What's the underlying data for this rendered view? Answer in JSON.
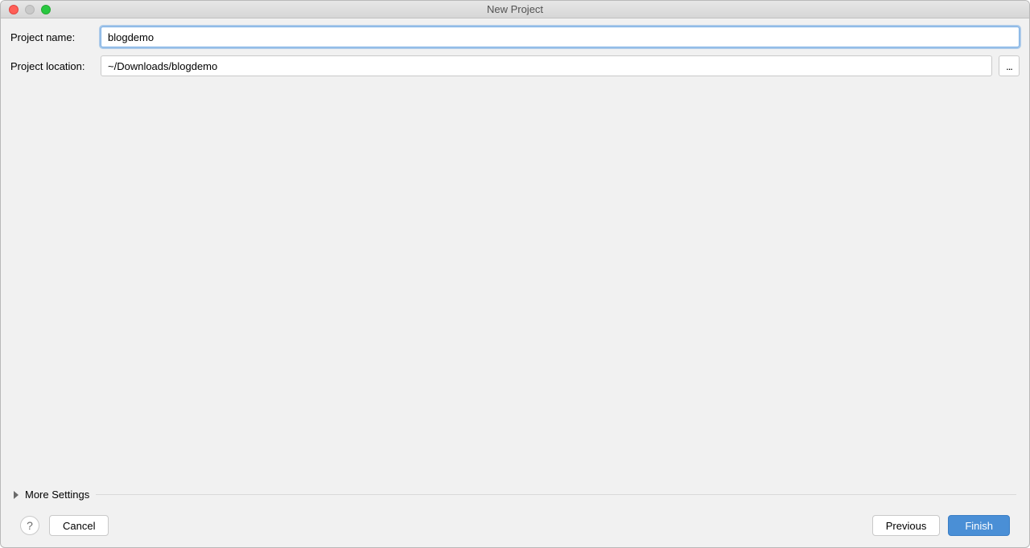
{
  "window": {
    "title": "New Project"
  },
  "form": {
    "project_name": {
      "label": "Project name:",
      "value": "blogdemo"
    },
    "project_location": {
      "label": "Project location:",
      "value": "~/Downloads/blogdemo",
      "browse_label": "..."
    }
  },
  "expander": {
    "label": "More Settings"
  },
  "footer": {
    "help_label": "?",
    "cancel_label": "Cancel",
    "previous_label": "Previous",
    "finish_label": "Finish"
  }
}
